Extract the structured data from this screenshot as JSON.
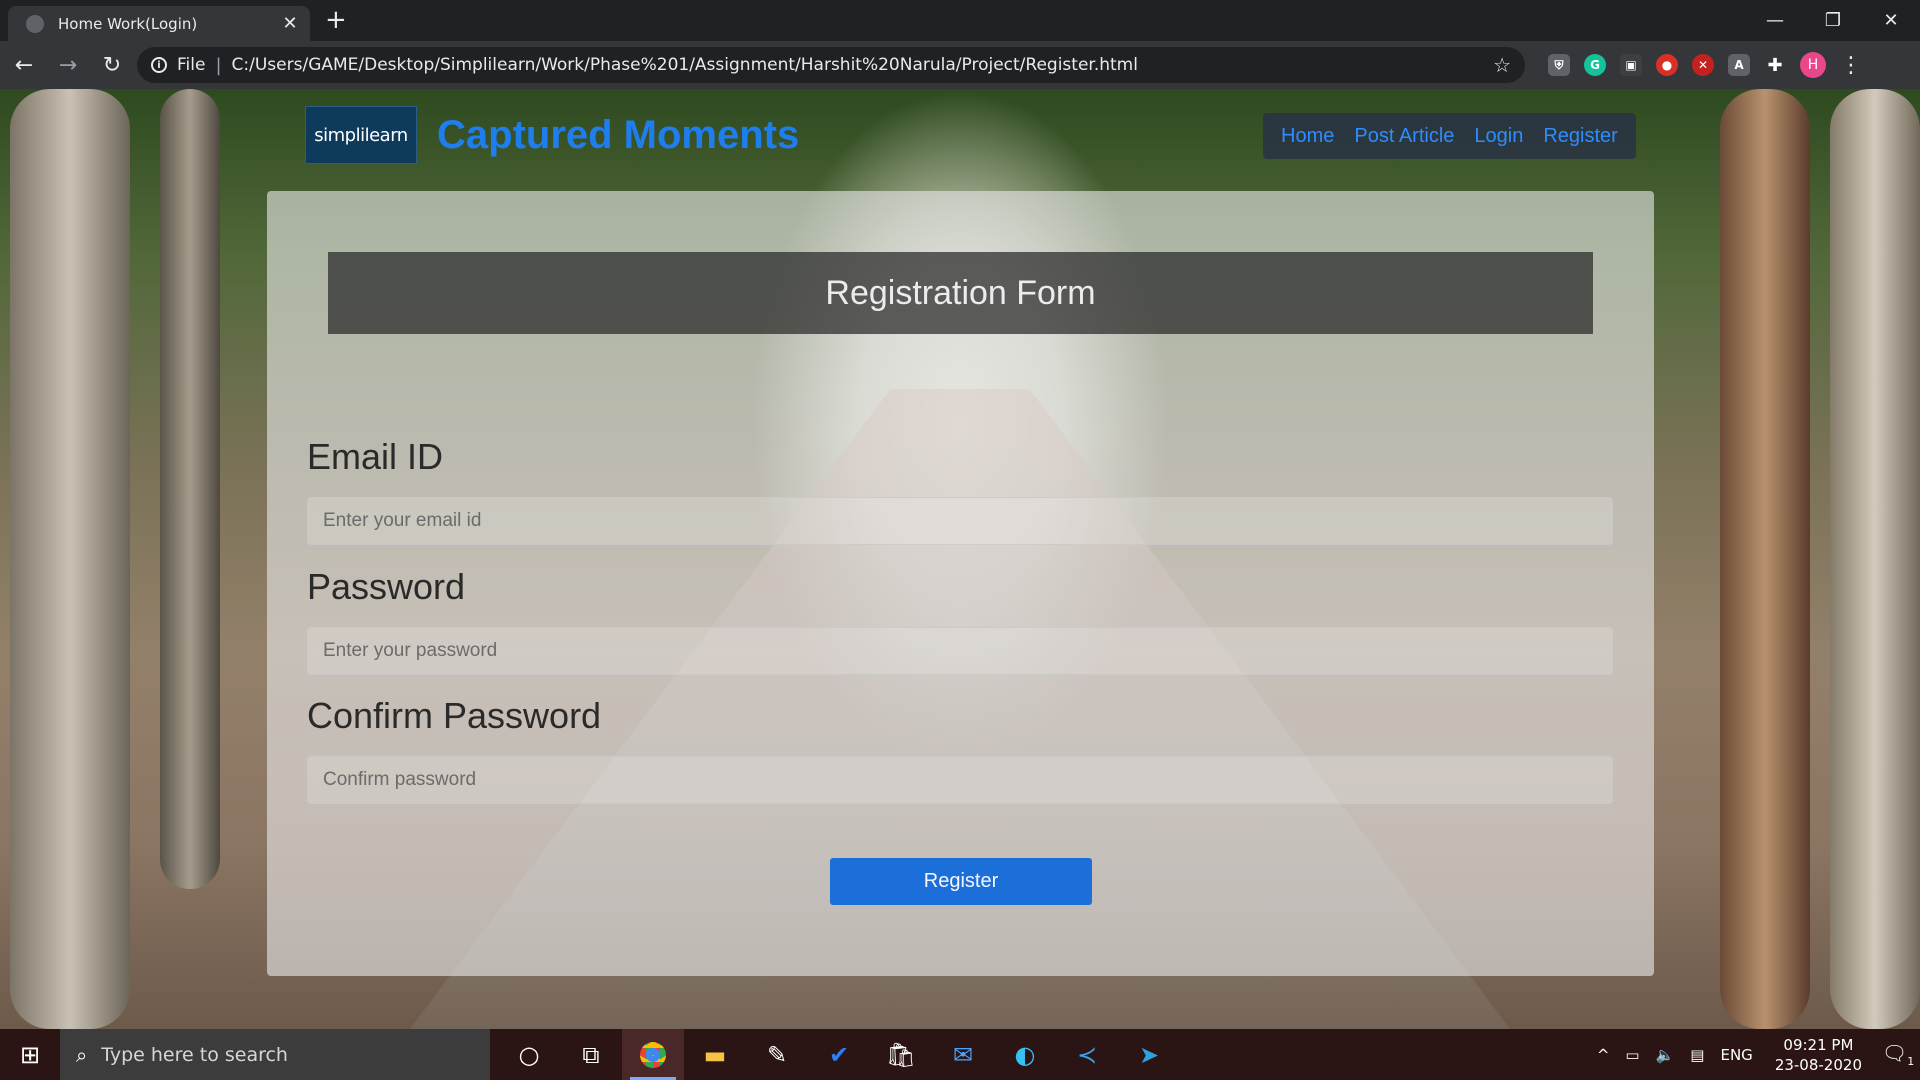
{
  "browser": {
    "tab_title": "Home Work(Login)",
    "tab_close": "✕",
    "new_tab": "+",
    "url_scheme": "File",
    "url": "C:/Users/GAME/Desktop/Simplilearn/Work/Phase%201/Assignment/Harshit%20Narula/Project/Register.html",
    "profile_initial": "H",
    "win_minimize": "—",
    "win_restore": "❐",
    "win_close": "✕"
  },
  "site": {
    "logo_text": "simplilearn",
    "brand_name": "Captured Moments",
    "nav": [
      "Home",
      "Post Article",
      "Login",
      "Register"
    ]
  },
  "form": {
    "heading": "Registration Form",
    "email_label": "Email ID",
    "email_placeholder": "Enter your email id",
    "password_label": "Password",
    "password_placeholder": "Enter your password",
    "confirm_label": "Confirm Password",
    "confirm_placeholder": "Confirm password",
    "submit_label": "Register"
  },
  "taskbar": {
    "search_placeholder": "Type here to search",
    "language": "ENG",
    "time": "09:21 PM",
    "date": "23-08-2020",
    "notification_count": "1"
  },
  "colors": {
    "brand": "#1e7ef0",
    "nav_link": "#2d8cff",
    "button": "#1c6fd9",
    "chrome_dark": "#202124",
    "taskbar": "#2b1414"
  }
}
